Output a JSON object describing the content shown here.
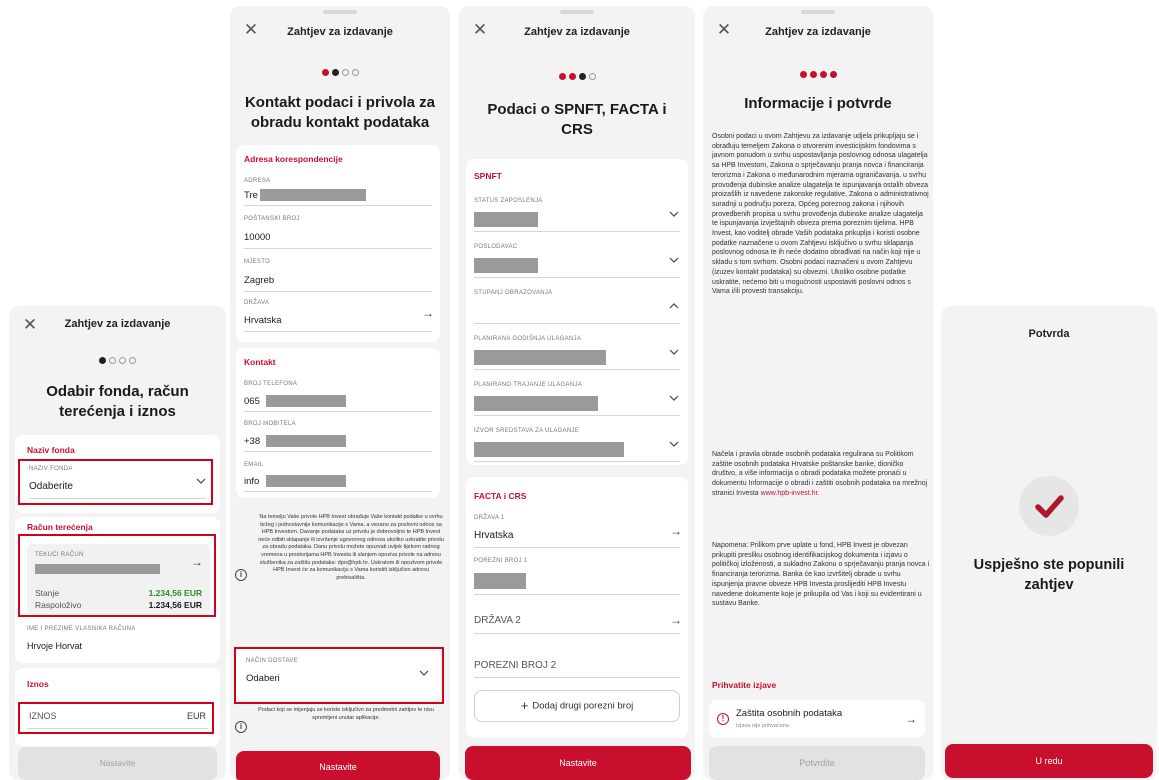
{
  "common": {
    "dialog_title": "Zahtjev za izdavanje",
    "continue_label": "Nastavite"
  },
  "screen1": {
    "heading": "Odabir fonda, račun terećenja i iznos",
    "fund_section": "Naziv fonda",
    "fund_label": "NAZIV FONDA",
    "fund_value": "Odaberite",
    "account_section": "Račun terećenja",
    "account_label": "TEKUĆI RAČUN",
    "balance_label": "Stanje",
    "balance_value": "1.234,56 EUR",
    "available_label": "Raspoloživo",
    "available_value": "1.234,56 EUR",
    "owner_label": "IME I PREZIME VLASNIKA RAČUNA",
    "owner_value": "Hrvoje Horvat",
    "amount_section": "Iznos",
    "amount_placeholder": "IZNOS",
    "amount_currency": "EUR",
    "continue_label": "Nastavite"
  },
  "screen2": {
    "heading": "Kontakt podaci i privola za obradu kontakt podataka",
    "address_section": "Adresa korespondencije",
    "address_label": "ADRESA",
    "address_value": "Tre",
    "postal_label": "POŠTANSKI BROJ",
    "postal_value": "10000",
    "city_label": "MJESTO",
    "city_value": "Zagreb",
    "country_label": "DRŽAVA",
    "country_value": "Hrvatska",
    "contact_section": "Kontakt",
    "phone_label": "BROJ TELEFONA",
    "phone_value": "065",
    "mobile_label": "BROJ MOBITELA",
    "mobile_value": "+38",
    "email_label": "EMAIL",
    "email_value": "info",
    "consent_text": "Na temelju Vaše privole HPB Invest obrađuje Vaše kontakt podatke u svrhu bržeg i jednostavnije komunikacije s Vama, a vezano za poslovni odnos sa HPB Investom. Davanje podataka uz privolu je dobrovoljno te HPB Invest neće odbiti sklapanje ili izvršenje ugovornog odnosa ukoliko uskratite privolu za obradu podataka. Danu privolu možete opozvati uvijek tijekom radnog vremena u prostorijama HPB Investa ili slanjem opoziva privole na adresu službenika za zaštitu podataka: dpo@hpb.hr. Uskratom ili opozivom privole HPB Invest će za komunikaciju s Vama koristiti isključivo adresu prebivališta.",
    "delivery_label": "NAČIN DOSTAVE",
    "delivery_value": "Odaberi",
    "note_text": "Podaci koji se mijenjaju se koriste isključivo za predmetni zahtjev te nisu spremljeni unutar aplikacije.",
    "continue_label": "Nastavite"
  },
  "screen3": {
    "heading": "Podaci o SPNFT, FACTA i CRS",
    "spnft_section": "SPNFT",
    "fields": [
      "STATUS ZAPOSLENJA",
      "POSLODAVAC",
      "STUPANJ OBRAZOVANJA",
      "PLANIRANA GODIŠNJA ULAGANJA",
      "PLANIRANO TRAJANJE ULAGANJA",
      "IZVOR SREDSTAVA ZA ULAGANJE"
    ],
    "facta_section": "FACTA i CRS",
    "country1_label": "DRŽAVA 1",
    "country1_value": "Hrvatska",
    "tax1_label": "POREZNI BROJ 1",
    "country2_placeholder": "DRŽAVA 2",
    "tax2_placeholder": "POREZNI BROJ 2",
    "add_tax_label": "Dodaj drugi porezni broj",
    "continue_label": "Nastavite"
  },
  "screen4": {
    "heading": "Informacije i potvrde",
    "para1": "Osobni podaci u ovom Zahtjevu za izdavanje udjela prikupljaju se i obrađuju temeljem Zakona o otvorenim investicijskim fondovima s javnom ponudom u svrhu uspostavljanja poslovnog odnosa ulagatelja sa HPB Investom, Zakona o sprječavanju pranja novca i financiranja terorizma i Zakona o međunarodnim mjerama ograničavanja, u svrhu provođenja dubinske analize ulagatelja te ispunjavanja ostalih obveza proizašlih iz navedene zakonske regulative, Zakona o administrativnoj suradnji u području poreza, Općeg poreznog zakona i njihovih provedbenih propisa u svrhu provođenja dubinske analize ulagatelja te ispunjavanja izvještajnih obveza prema poreznim tijelima. HPB Invest, kao voditelj obrade Vaših podataka prikuplja i koristi osobne podatke naznačene u ovom Zahtjevu isključivo u svrhu sklapanja poslovnog odnosa te ih neće dodatno obrađivati na način koji nije u skladu s tom svrhom. Osobni podaci naznačeni u ovom Zahtjevu (izuzev kontakt podataka) su obvezni. Ukoliko osobne podatke uskratite, nećemo biti u mogućnosti uspostaviti poslovni odnos s Vama i/ili provesti transakciju.",
    "para2": "Načela i pravila obrade osobnih podataka regulirana su Politikom zaštite osobnih podataka Hrvatske poštanske banke, dioničko društvo, a više informacija o obradi podataka možete pronaći u dokumentu Informacije o obradi i zaštiti osobnih podataka na mrežnoj stranici Investa",
    "link": "www.hpb-invest.hr.",
    "para3": "Napomena: Prilikom prve uplate u fond, HPB Invest je obvezan prikupiti presliku osobnog identifikacijskog dokumenta i izjavu o političkoj izloženosti, a sukladno Zakonu o sprječavanju pranja novca i financiranja terorizma. Banka će kao izvršitelj obrade u svrhu ispunjenja pravne obveze HPB Investa proslijediti HPB Investu navedene dokumente koje je prikupila od Vas i koji su evidentirani u sustavu Banke.",
    "accept_section": "Prihvatite izjave",
    "statement_title": "Zaštita osobnih podataka",
    "statement_sub": "Izjava nije prihvaćena",
    "confirm_label": "Potvrdite"
  },
  "screen5": {
    "title": "Potvrda",
    "message": "Uspješno ste popunili zahtjev",
    "ok_label": "U redu"
  },
  "colors": {
    "accent": "#c8102e",
    "highlight": "#d0021b",
    "background": "#f3f3f3"
  }
}
